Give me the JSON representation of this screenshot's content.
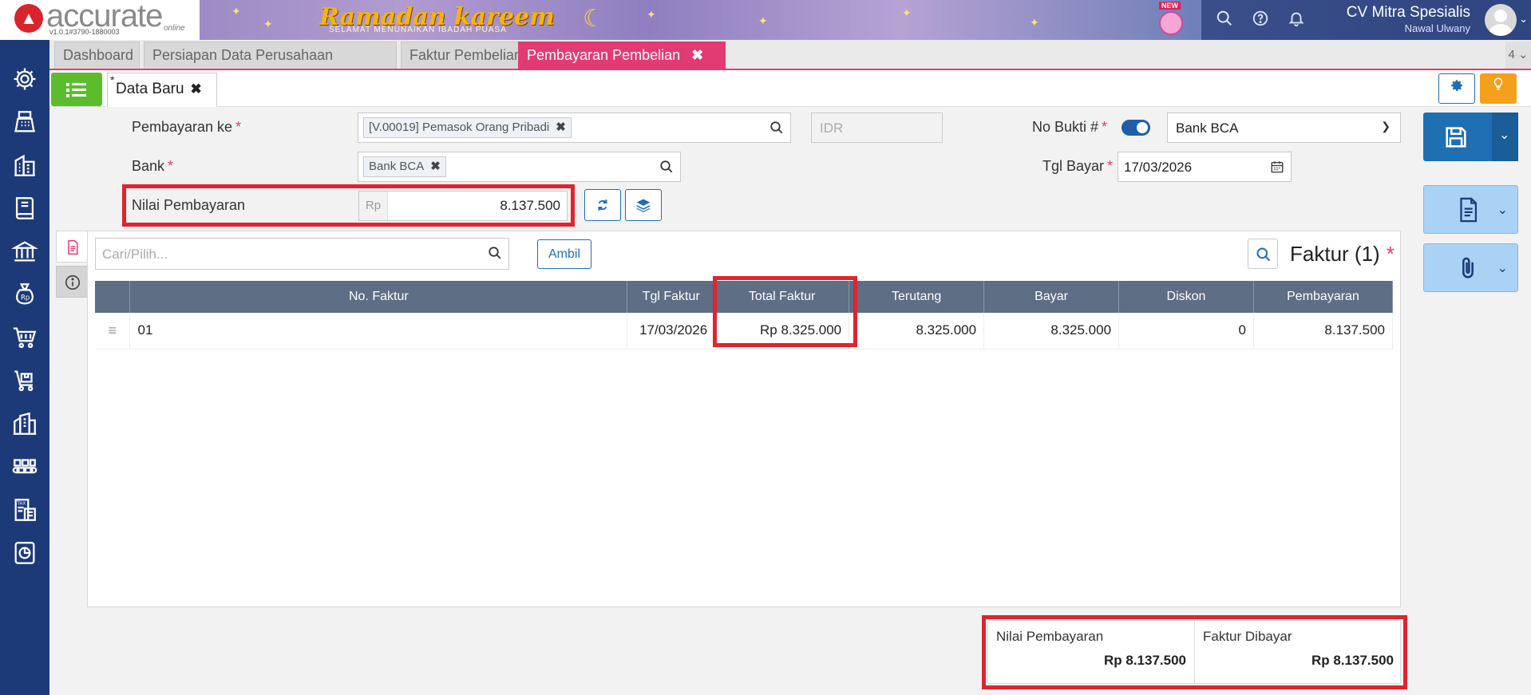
{
  "header": {
    "logo_text": "accurate",
    "logo_online": "online",
    "version": "v1.0.1#3790-1880003",
    "banner_title": "Ramadan kareem",
    "banner_subtitle": "SELAMAT MENUNAIKAN IBADAH PUASA",
    "new_badge": "NEW",
    "company_name": "CV Mitra Spesialis",
    "user_name": "Nawal Ulwany"
  },
  "tabs": [
    {
      "label": "Dashboard"
    },
    {
      "label": "Persiapan Data Perusahaan"
    },
    {
      "label": "Faktur Pembelian"
    },
    {
      "label": "Pembayaran Pembelian"
    }
  ],
  "tab_count": "4",
  "doc_tab": {
    "label": "Data Baru",
    "modified_mark": "*"
  },
  "form": {
    "pembayaran_ke_label": "Pembayaran ke",
    "pembayaran_ke_value": "[V.00019] Pemasok Orang Pribadi",
    "currency": "IDR",
    "no_bukti_label": "No Bukti #",
    "no_bukti_value": "Bank BCA",
    "bank_label": "Bank",
    "bank_value": "Bank BCA",
    "tgl_bayar_label": "Tgl Bayar",
    "tgl_bayar_value": "17/03/2026",
    "nilai_label": "Nilai Pembayaran",
    "nilai_prefix": "Rp",
    "nilai_value": "8.137.500"
  },
  "panel": {
    "search_placeholder": "Cari/Pilih...",
    "ambil_label": "Ambil",
    "title": "Faktur (1)",
    "columns": [
      "No. Faktur",
      "Tgl Faktur",
      "Total Faktur",
      "Terutang",
      "Bayar",
      "Diskon",
      "Pembayaran"
    ],
    "rows": [
      {
        "no_faktur": "01",
        "tgl_faktur": "17/03/2026",
        "total_faktur": "Rp 8.325.000",
        "terutang": "8.325.000",
        "bayar": "8.325.000",
        "diskon": "0",
        "pembayaran": "8.137.500"
      }
    ]
  },
  "summary": {
    "nilai_label": "Nilai Pembayaran",
    "nilai_value": "Rp 8.137.500",
    "faktur_label": "Faktur Dibayar",
    "faktur_value": "Rp 8.137.500"
  },
  "colors": {
    "accent_pink": "#e23b74",
    "brand_blue": "#1f6fb2",
    "sidebar_navy": "#1d3a78",
    "highlight_red": "#e0242f",
    "list_green": "#5bbd2b"
  }
}
